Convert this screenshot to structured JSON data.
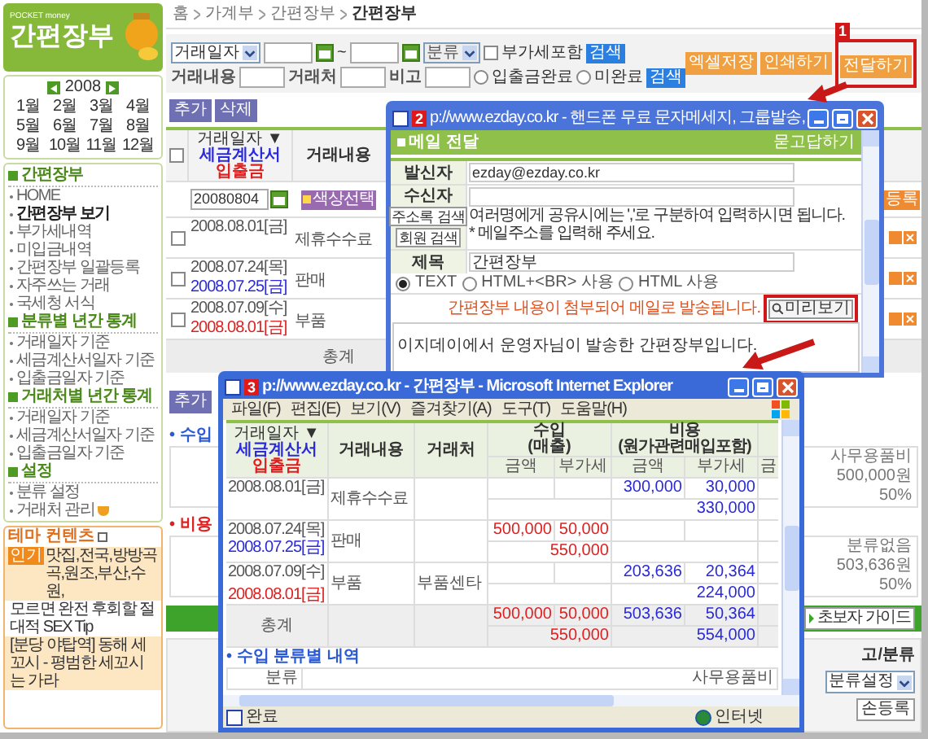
{
  "logo": {
    "brand": "POCKET money",
    "title": "간편장부"
  },
  "calendar": {
    "year": "2008",
    "months": [
      "1월",
      "2월",
      "3월",
      "4월",
      "5월",
      "6월",
      "7월",
      "8월",
      "9월",
      "10월",
      "11월",
      "12월"
    ]
  },
  "nav": [
    {
      "heading": "간편장부",
      "items": [
        {
          "label": "HOME",
          "selected": false
        },
        {
          "label": "간편장부 보기",
          "selected": true
        },
        {
          "label": "부가세내역",
          "selected": false
        },
        {
          "label": "미입금내역",
          "selected": false
        },
        {
          "label": "간편장부 일괄등록",
          "selected": false
        },
        {
          "label": "자주쓰는 거래",
          "selected": false
        },
        {
          "label": "국세청 서식",
          "selected": false
        }
      ]
    },
    {
      "heading": "분류별 년간 통계",
      "items": [
        {
          "label": "거래일자 기준",
          "selected": false
        },
        {
          "label": "세금계산서일자 기준",
          "selected": false
        },
        {
          "label": "입출금일자 기준",
          "selected": false
        }
      ]
    },
    {
      "heading": "거래처별 년간 통계",
      "items": [
        {
          "label": "거래일자 기준",
          "selected": false
        },
        {
          "label": "세금계산서일자 기준",
          "selected": false
        },
        {
          "label": "입출금일자 기준",
          "selected": false
        }
      ]
    },
    {
      "heading": "설정",
      "items": [
        {
          "label": "분류 설정",
          "selected": false
        },
        {
          "label": "거래처 관리",
          "selected": false,
          "badge_icon": true
        }
      ]
    }
  ],
  "theme": {
    "title": "테마 컨텐츠",
    "items": [
      {
        "badge": "인기",
        "text": "맛집,전국,방방곡곡,원조,부산,수원,",
        "highlighted": true
      },
      {
        "text": "모르면 완전 후회할 절대적 SEX Tip",
        "highlighted": false
      },
      {
        "text": "[분당 야탑역] 동해 세꼬시 - 평범한 세꼬시는 가라",
        "highlighted": true
      }
    ]
  },
  "breadcrumb": [
    "홈",
    "가계부",
    "간편장부",
    "간편장부"
  ],
  "filters": {
    "date_type": "거래일자",
    "range_sep": "~",
    "category": "분류",
    "vat": {
      "label": "부가세포함",
      "checked": false
    },
    "search": "검색",
    "labels": [
      "거래내용",
      "거래처",
      "비고"
    ],
    "status": [
      {
        "label": "입출금완료",
        "selected": false
      },
      {
        "label": "미완료",
        "selected": false
      }
    ],
    "search2": "검색"
  },
  "actions": [
    {
      "label": "엑셀저장",
      "highlighted": false
    },
    {
      "label": "인쇄하기",
      "highlighted": false
    },
    {
      "label": "전달하기",
      "highlighted": true,
      "badge": "1"
    }
  ],
  "list_buttons": [
    "추가",
    "삭제"
  ],
  "table": {
    "select_all_checked": false,
    "header": {
      "date": "거래일자 ▼",
      "tax": "세금계산서",
      "cash": "입출금",
      "content": "거래내용"
    },
    "date_filter": "20080804",
    "color_button": "색상선택",
    "register": "등록",
    "total": "총계",
    "rows": [
      {
        "checked": false,
        "dates": [
          {
            "kind": "trade",
            "text": "2008.08.01[금]"
          }
        ],
        "content": "제휴수수료"
      },
      {
        "checked": false,
        "dates": [
          {
            "kind": "trade",
            "text": "2008.07.24[목]"
          },
          {
            "kind": "tax",
            "text": "2008.07.25[금]"
          }
        ],
        "content": "판매"
      },
      {
        "checked": false,
        "dates": [
          {
            "kind": "trade",
            "text": "2008.07.09[수]"
          },
          {
            "kind": "cash",
            "text": "2008.08.01[금]"
          }
        ],
        "content": "부품"
      }
    ]
  },
  "add_button": "추가",
  "sections": [
    {
      "kind": "income",
      "label": "• 수입",
      "name": "사무용품비",
      "amount": "500,000원",
      "share": "50%"
    },
    {
      "kind": "expense",
      "label": "• 비용",
      "name": "분류없음",
      "amount": "503,636원",
      "share": "50%"
    }
  ],
  "guide_button": "초보자 가이드",
  "bottom_table": {
    "column": "고/분류",
    "select": "분류설정",
    "button": "손등록"
  },
  "mail_window": {
    "badge": "2",
    "title": "p://www.ezday.co.kr - 핸드폰 무료 문자메세지, 그룹발송,",
    "heading": "메일 전달",
    "help_link": "묻고답하기",
    "sender_label": "발신자",
    "sender": "ezday@ezday.co.kr",
    "recipient_label": "수신자",
    "recipient_buttons": [
      "주소록 검색",
      "회원 검색"
    ],
    "hints": [
      "여러명에게 공유시에는 ','로 구분하여 입력하시면 됩니다.",
      "* 메일주소를 입력해 주세요."
    ],
    "subject_label": "제목",
    "subject": "간편장부",
    "formats": [
      {
        "label": "TEXT",
        "selected": true
      },
      {
        "label": "HTML+<BR> 사용",
        "selected": false
      },
      {
        "label": "HTML 사용",
        "selected": false
      }
    ],
    "notice": "간편장부 내용이 첨부되어 메일로 발송됩니다.",
    "preview": {
      "label": "미리보기",
      "highlighted": true
    },
    "body": "이지데이에서 운영자님이 발송한 간편장부입니다."
  },
  "ie_window": {
    "badge": "3",
    "title": "p://www.ezday.co.kr - 간편장부 - Microsoft Internet Explorer",
    "menu": [
      "파일(F)",
      "편집(E)",
      "보기(V)",
      "즐겨찾기(A)",
      "도구(T)",
      "도움말(H)"
    ],
    "header": {
      "date": "거래일자 ▼",
      "tax": "세금계산서",
      "cash": "입출금",
      "content": "거래내용",
      "vendor": "거래처",
      "income": [
        "수입",
        "(매출)"
      ],
      "expense": [
        "비용",
        "(원가관련매입포함)"
      ],
      "sub": [
        "금액",
        "부가세",
        "금액",
        "부가세",
        "금"
      ]
    },
    "rows": [
      {
        "dates": [
          {
            "kind": "trade",
            "text": "2008.08.01[금]"
          }
        ],
        "content": "제휴수수료",
        "expense": {
          "amount": "300,000",
          "vat": "30,000",
          "total": "330,000"
        }
      },
      {
        "dates": [
          {
            "kind": "trade",
            "text": "2008.07.24[목]"
          },
          {
            "kind": "tax",
            "text": "2008.07.25[금]"
          }
        ],
        "content": "판매",
        "income": {
          "amount": "500,000",
          "vat": "50,000",
          "total": "550,000"
        }
      },
      {
        "dates": [
          {
            "kind": "trade",
            "text": "2008.07.09[수]"
          },
          {
            "kind": "cash",
            "text": "2008.08.01[금]"
          }
        ],
        "content": "부품",
        "vendor": "부품센타",
        "expense": {
          "amount": "203,636",
          "vat": "20,364",
          "total": "224,000"
        }
      }
    ],
    "total": {
      "label": "총계",
      "income": {
        "amount": "500,000",
        "vat": "50,000",
        "total": "550,000"
      },
      "expense": {
        "amount": "503,636",
        "vat": "50,364",
        "total": "554,000"
      }
    },
    "section": "• 수입 분류별 내역",
    "section_header": "분류",
    "section_value": "사무용품비",
    "status": "완료",
    "zone": "인터넷"
  }
}
